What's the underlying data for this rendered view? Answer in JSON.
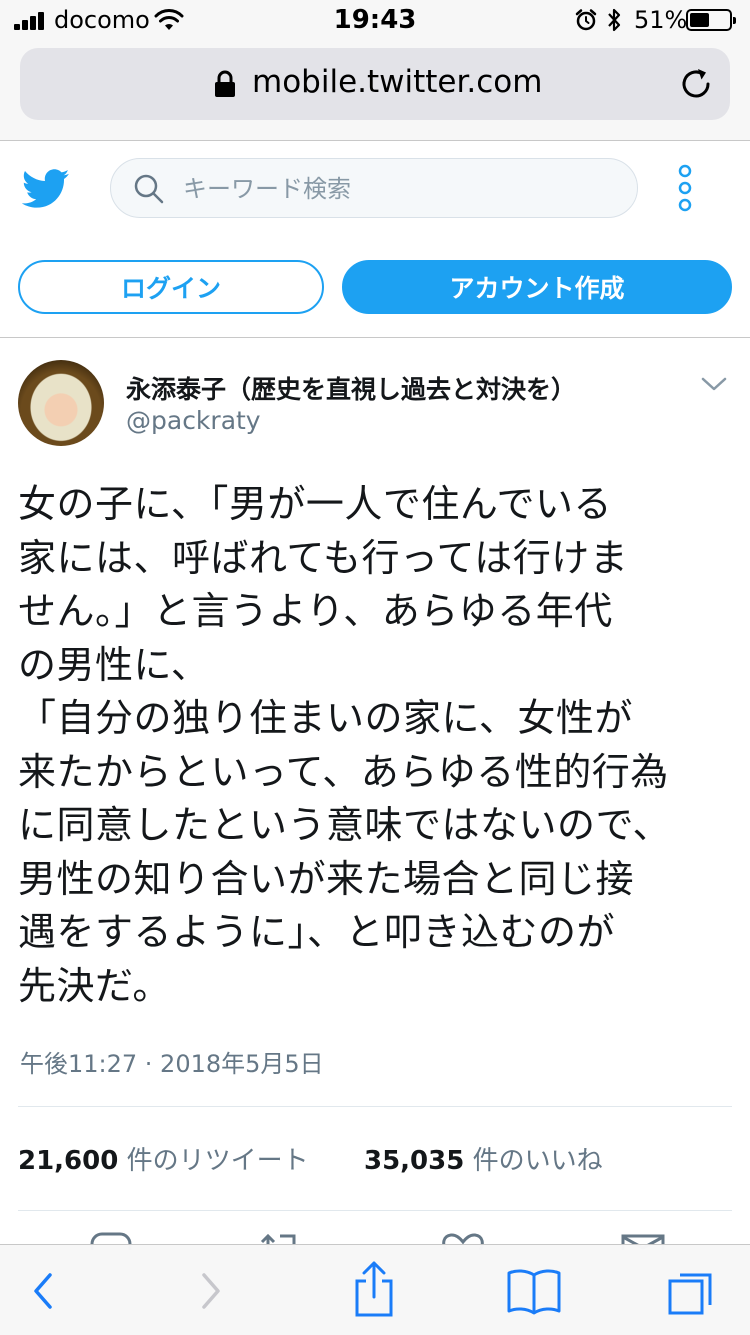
{
  "status_bar": {
    "carrier": "docomo",
    "time": "19:43",
    "battery_percent": "51%",
    "battery_level": 0.51
  },
  "browser": {
    "url": "mobile.twitter.com"
  },
  "header": {
    "search_placeholder": "キーワード検索",
    "login_label": "ログイン",
    "signup_label": "アカウント作成"
  },
  "tweet": {
    "author_name": "永添泰子（歴史を直視し過去と対決を）",
    "author_handle": "@packraty",
    "text": "女の子に、「男が一人で住んでいる\n家には、呼ばれても行っては行けま\nせん。」と言うより、あらゆる年代\nの男性に、\n「自分の独り住まいの家に、女性が\n来たからといって、あらゆる性的行為\nに同意したという意味ではないので、\n男性の知り合いが来た場合と同じ接\n遇をするように」、と叩き込むのが\n先決だ。",
    "timestamp": "午後11:27 · 2018年5月5日",
    "retweets": {
      "count": "21,600",
      "label": "件のリツイート"
    },
    "likes": {
      "count": "35,035",
      "label": "件のいいね"
    }
  },
  "icons": {
    "twitter_logo": "twitter-bird-icon",
    "search": "search-icon",
    "more": "more-vertical-icon",
    "lock": "lock-icon",
    "reload": "reload-icon",
    "chevron": "chevron-down-icon"
  },
  "colors": {
    "twitter_blue": "#1da1f2",
    "text_primary": "#14171a",
    "text_secondary": "#657786",
    "safari_blue": "#1a7cf8"
  }
}
